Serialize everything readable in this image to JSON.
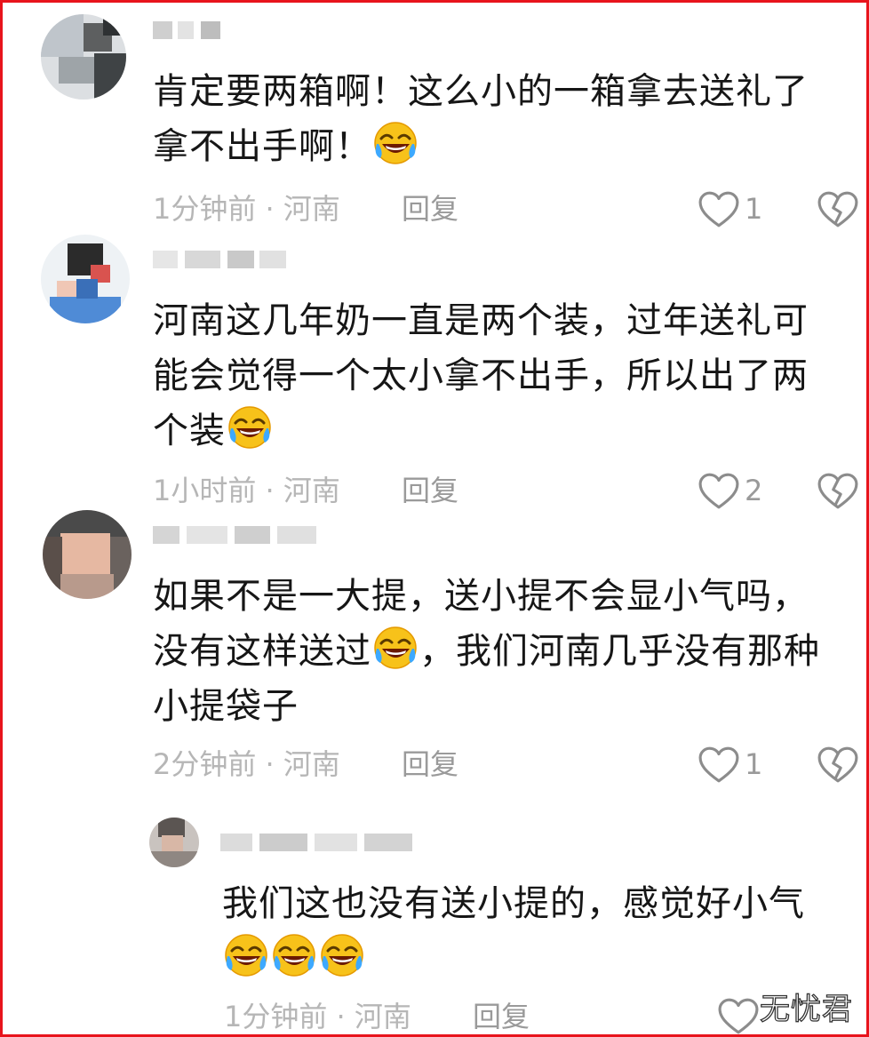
{
  "colors": {
    "frame": "#e8141c",
    "text": "#161616",
    "meta": "#b6b6b6",
    "action": "#9a9a9a"
  },
  "comments": [
    {
      "text": "肯定要两箱啊！这么小的一箱拿去送礼了拿不出手啊！",
      "line1": "肯定要两箱啊！这么小的一箱拿去送礼了",
      "line2": "拿不出手啊！",
      "meta": "1分钟前 · 河南",
      "reply": "回复",
      "likes": "1",
      "emoji": "rofl-emoji"
    },
    {
      "text": "河南这几年奶一直是两个装，过年送礼可能会觉得一个太小拿不出手，所以出了两个装",
      "line1": "河南这几年奶一直是两个装，过年送礼可",
      "line2": "能会觉得一个太小拿不出手，所以出了两",
      "line3": "个装",
      "meta": "1小时前 · 河南",
      "reply": "回复",
      "likes": "2",
      "emoji": "rofl-emoji"
    },
    {
      "text": "如果不是一大提，送小提不会显小气吗，没有这样送过，我们河南几乎没有那种小提袋子",
      "line1": "如果不是一大提，送小提不会显小气吗，",
      "line2a": "没有这样送过",
      "line2b": "，我们河南几乎没有那种",
      "line3": "小提袋子",
      "meta": "2分钟前 · 河南",
      "reply": "回复",
      "likes": "1",
      "emoji": "rofl-emoji"
    },
    {
      "text": "我们这也没有送小提的，感觉好小气",
      "meta": "1分钟前 · 河南",
      "reply": "回复",
      "emoji": "rofl-emoji"
    }
  ],
  "icons": {
    "like": "heart-outline-icon",
    "dislike": "broken-heart-icon"
  },
  "watermark": "无忧君"
}
